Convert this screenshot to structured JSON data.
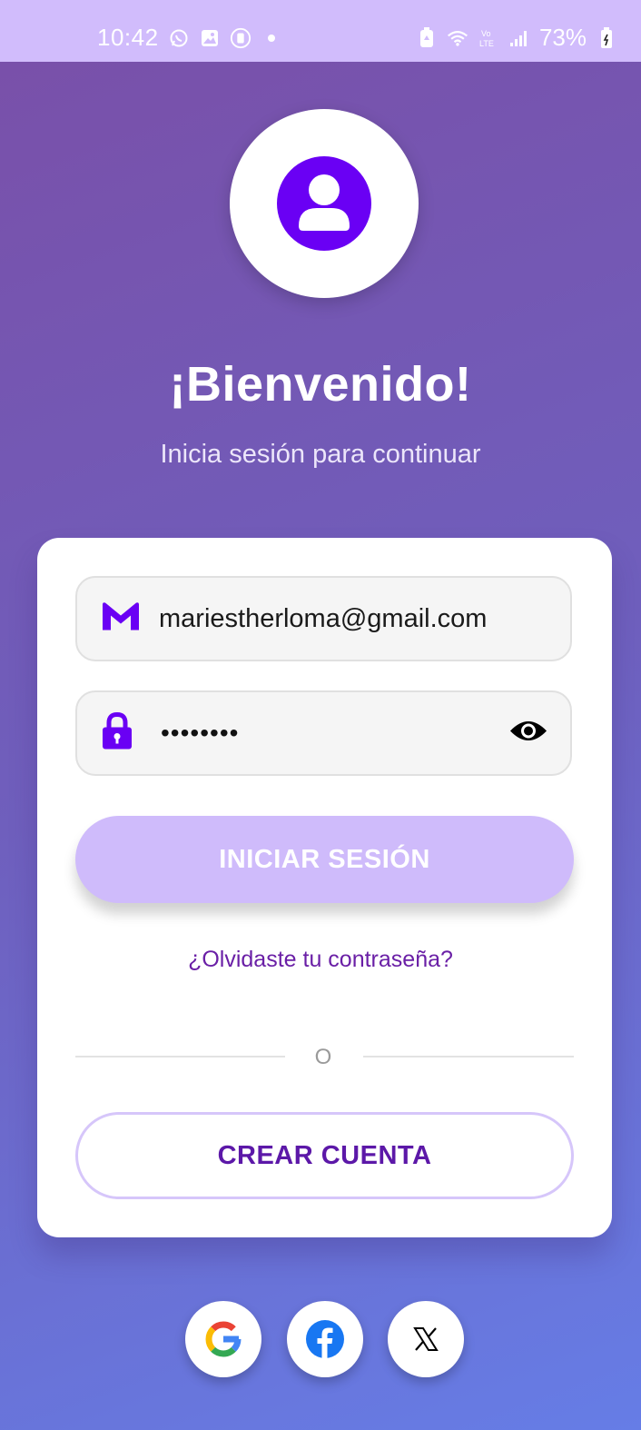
{
  "status_bar": {
    "time": "10:42",
    "battery": "73%",
    "left_icons": [
      "whatsapp-icon",
      "gallery-icon",
      "screen-record-icon",
      "dot-icon"
    ],
    "right_icons": [
      "battery-saver-icon",
      "wifi-icon",
      "volte-icon",
      "signal-icon",
      "battery-icon"
    ]
  },
  "header": {
    "title": "¡Bienvenido!",
    "subtitle": "Inicia sesión para continuar"
  },
  "login_form": {
    "email_value": "mariestherloma@gmail.com",
    "password_mask": "••••••••",
    "login_button": "INICIAR SESIÓN",
    "forgot_password": "¿Olvidaste tu contraseña?",
    "divider_text": "O",
    "create_account_button": "CREAR CUENTA"
  },
  "social": [
    "google",
    "facebook",
    "x"
  ],
  "colors": {
    "accent": "#6a00f4",
    "button_primary": "#cfbbfb",
    "link": "#6a1fa6",
    "status_bar": "#d1bcfc"
  }
}
